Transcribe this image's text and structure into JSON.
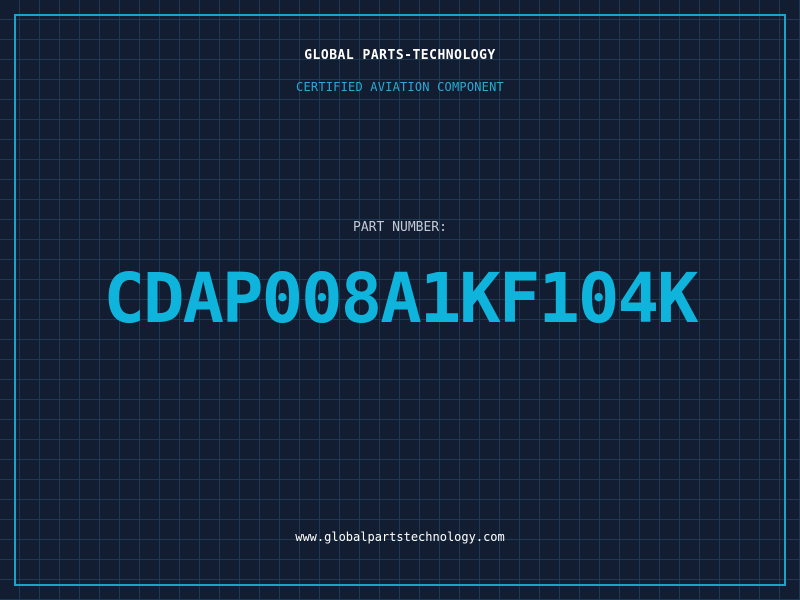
{
  "colors": {
    "background": "#131d31",
    "grid_line": "#1d3a52",
    "frame_border": "#1aa3c8",
    "title_text": "#ffffff",
    "accent_text": "#29a9d6",
    "label_text": "#c2cad6",
    "part_number_text": "#0fb4dc",
    "website_text": "#ffffff"
  },
  "header": {
    "company_name": "GLOBAL PARTS-TECHNOLOGY",
    "tagline": "CERTIFIED AVIATION COMPONENT"
  },
  "part": {
    "label": "PART NUMBER:",
    "number": "CDAP008A1KF104K"
  },
  "footer": {
    "website": "www.globalpartstechnology.com"
  }
}
